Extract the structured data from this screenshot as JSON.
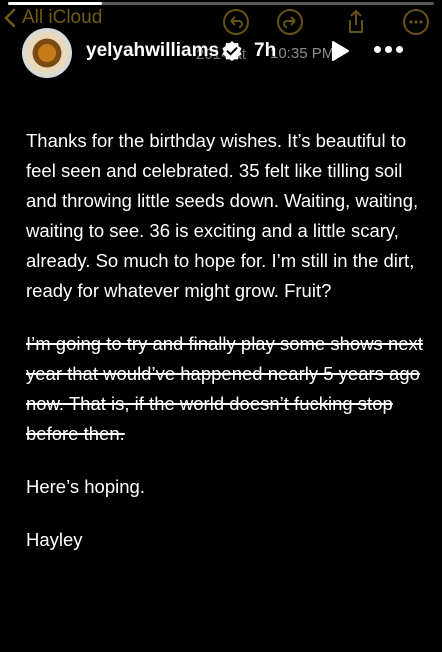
{
  "toolbar": {
    "back_label": "All iCloud",
    "icons": [
      "undo-icon",
      "redo-icon",
      "share-icon",
      "more-icon"
    ]
  },
  "story": {
    "progress": 0.22,
    "username": "yelyahwilliams",
    "verified": true,
    "time_ago": "7h",
    "note_date_fragment": "2014 at",
    "note_time": "10:35 PM"
  },
  "note": {
    "paragraphs": [
      {
        "text": "Thanks for the birthday wishes. It’s beautiful to feel seen and celebrated. 35 felt like tilling soil and throwing little seeds down. Waiting, waiting, waiting to see. 36 is exciting and a little scary, already. So much to hope for. I’m still in the dirt, ready for whatever might grow. Fruit?",
        "struck": false
      },
      {
        "text": "I’m going to try and finally play some shows next year that would’ve happened nearly 5 years ago now. That is, if the world doesn’t fucking stop before then.",
        "struck": true
      },
      {
        "text": "Here’s hoping.",
        "struck": false
      },
      {
        "text": "Hayley",
        "struck": false
      }
    ]
  },
  "colors": {
    "background": "#000000",
    "text": "#ffffff",
    "notes_accent": "#c9a227"
  }
}
